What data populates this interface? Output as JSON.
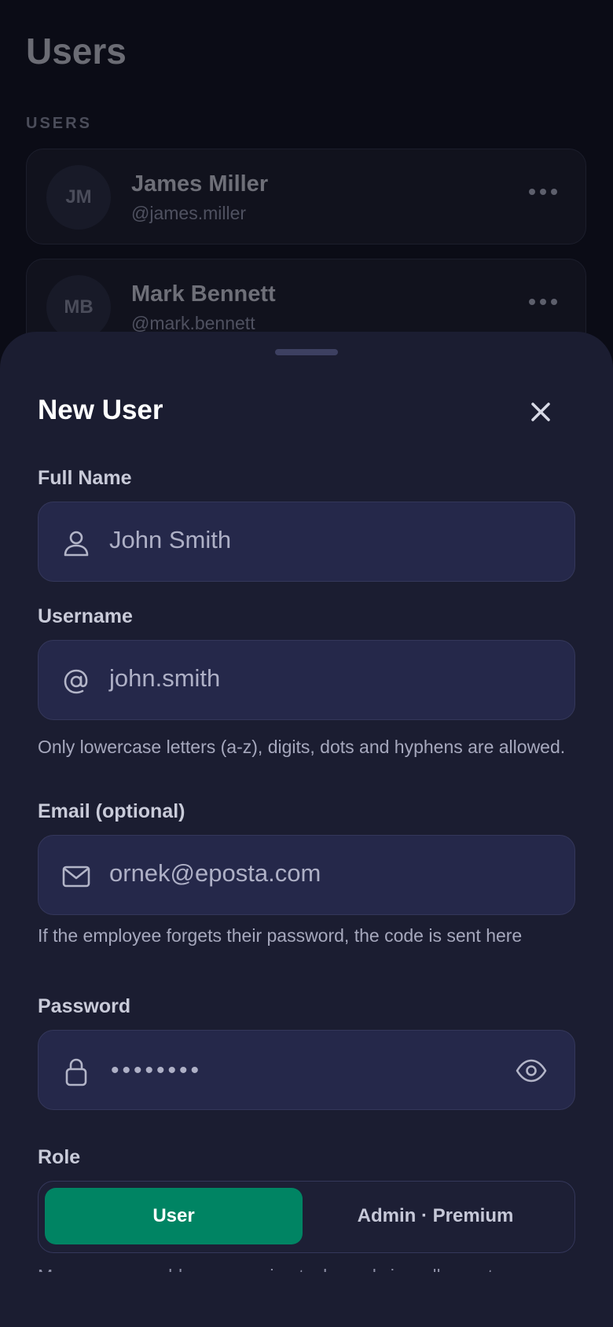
{
  "background": {
    "title": "Users",
    "section_label": "USERS",
    "users": [
      {
        "initials": "JM",
        "name": "James Miller",
        "handle": "@james.miller"
      },
      {
        "initials": "MB",
        "name": "Mark Bennett",
        "handle": "@mark.bennett"
      }
    ]
  },
  "sheet": {
    "title": "New User",
    "full_name": {
      "label": "Full Name",
      "value": "John Smith",
      "icon": "person-icon"
    },
    "username": {
      "label": "Username",
      "value": "john.smith",
      "icon": "at-icon",
      "help": "Only lowercase letters (a-z), digits, dots and hyphens are allowed."
    },
    "email": {
      "label": "Email (optional)",
      "value": "ornek@eposta.com",
      "icon": "mail-icon",
      "help": "If the employee forgets their password, the code is sent here"
    },
    "password": {
      "label": "Password",
      "value": "••••••••",
      "icon": "lock-icon"
    },
    "role": {
      "label": "Role",
      "options": [
        "User",
        "Admin · Premium"
      ],
      "selected": "User",
      "help": "Manager, can add users, assign tasks and view all reports"
    }
  },
  "colors": {
    "accent": "#008463",
    "sheet": "#1b1d31",
    "field": "#25284a"
  }
}
